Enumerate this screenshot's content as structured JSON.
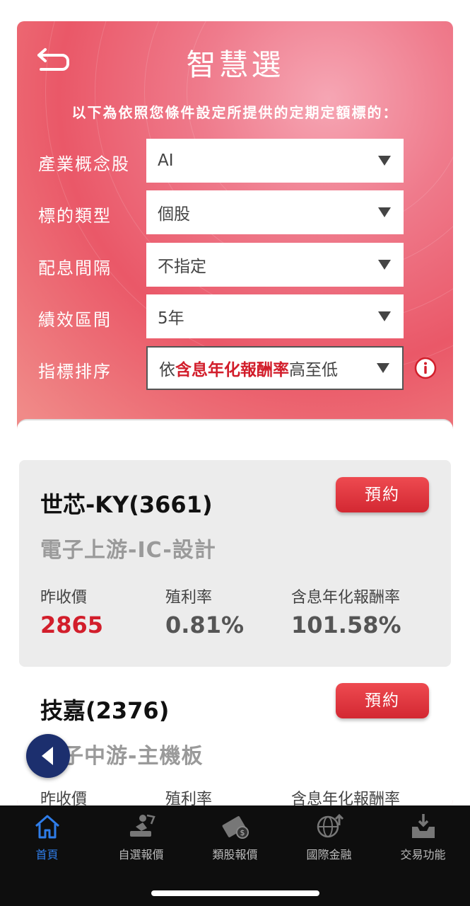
{
  "header": {
    "title": "智慧選",
    "subtitle": "以下為依照您條件設定所提供的定期定額標的："
  },
  "filters": [
    {
      "label": "產業概念股",
      "value": "AI"
    },
    {
      "label": "標的類型",
      "value": "個股"
    },
    {
      "label": "配息間隔",
      "value": "不指定"
    },
    {
      "label": "績效區間",
      "value": "5年"
    },
    {
      "label": "指標排序",
      "value_prefix": "依",
      "value_highlight": "含息年化報酬率",
      "value_suffix": "高至低"
    }
  ],
  "stocks": [
    {
      "name": "世芯-KY(3661)",
      "industry": "電子上游-IC-設計",
      "reserve_label": "預約",
      "metrics": [
        {
          "label": "昨收價",
          "value": "2865"
        },
        {
          "label": "殖利率",
          "value": "0.81%"
        },
        {
          "label": "含息年化報酬率",
          "value": "101.58%"
        }
      ]
    },
    {
      "name": "技嘉(2376)",
      "industry": "電子中游-主機板",
      "reserve_label": "預約",
      "metrics": [
        {
          "label": "昨收價"
        },
        {
          "label": "殖利率"
        },
        {
          "label": "含息年化報酬率"
        }
      ]
    }
  ],
  "tabbar": {
    "tabs": [
      {
        "label": "首頁",
        "icon": "home-icon",
        "active": true
      },
      {
        "label": "自選報價",
        "icon": "watchlist-icon"
      },
      {
        "label": "類股報價",
        "icon": "sector-quote-icon"
      },
      {
        "label": "國際金融",
        "icon": "globe-icon"
      },
      {
        "label": "交易功能",
        "icon": "trade-icon"
      }
    ]
  },
  "colors": {
    "accent_red": "#d21e2b",
    "tab_active": "#2f7de9",
    "tabbar_bg": "#0e0e0e"
  }
}
